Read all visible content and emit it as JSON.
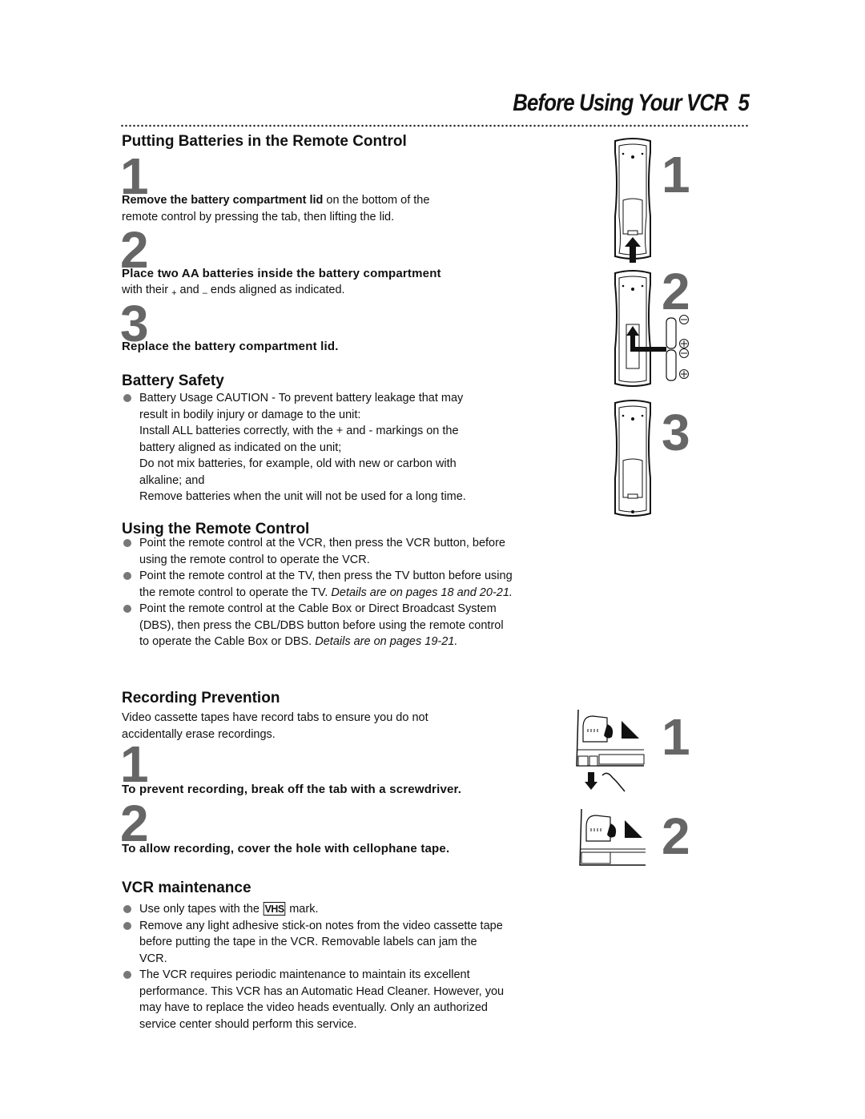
{
  "header": {
    "title": "Before Using Your VCR",
    "page_number": "5"
  },
  "batteries": {
    "heading": "Putting Batteries in the Remote Control",
    "steps": [
      {
        "number": "1",
        "bold": "Remove the battery compartment lid",
        "text": " on the bottom of the",
        "text2": "remote control by pressing the tab, then lifting the lid."
      },
      {
        "number": "2",
        "bold": "Place two AA batteries inside the battery compartment",
        "text_pre": "with their ",
        "plus": "+",
        "text_mid": " and ",
        "minus": "–",
        "text_post": " ends aligned as indicated."
      },
      {
        "number": "3",
        "bold": "Replace the battery compartment lid."
      }
    ]
  },
  "battery_safety": {
    "heading": "Battery Safety",
    "items": [
      {
        "lines": [
          "Battery Usage CAUTION - To prevent battery leakage that may",
          "result in bodily injury or damage to the unit:",
          "Install ALL batteries correctly, with the + and - markings on the",
          "battery aligned as indicated on the unit;",
          "Do not mix batteries, for example, old with new or carbon with",
          "alkaline; and",
          "Remove batteries when the unit will not be used for a long time."
        ]
      }
    ]
  },
  "using_remote": {
    "heading": "Using the Remote Control",
    "items": [
      {
        "text": "Point the remote control at the VCR, then press the VCR button, before using the remote control to operate the VCR.",
        "note": ""
      },
      {
        "text": "Point the remote control at the TV, then press the TV button before using the remote control to operate the TV. ",
        "note": "Details are on pages 18 and 20-21."
      },
      {
        "text": "Point the remote control at the Cable Box or Direct Broadcast System (DBS), then press the CBL/DBS button before using the remote control to operate the Cable Box or DBS. ",
        "note": "Details are on pages 19-21."
      }
    ]
  },
  "recording_prevention": {
    "heading": "Recording Prevention",
    "intro": "Video cassette tapes have record tabs to ensure you do not accidentally erase recordings.",
    "steps": [
      {
        "number": "1",
        "bold": "To prevent recording, break off the tab with a screwdriver."
      },
      {
        "number": "2",
        "bold": "To allow recording, cover the hole with cellophane tape."
      }
    ]
  },
  "vcr_maintenance": {
    "heading": "VCR maintenance",
    "item1_pre": "Use only tapes with the ",
    "vhs_mark": "VHS",
    "item1_post": " mark.",
    "items": [
      "Remove any light adhesive stick-on notes from the video cassette tape before putting the tape in the VCR. Removable labels can jam the VCR.",
      "The VCR requires periodic maintenance to maintain its excellent performance. This VCR has an Automatic Head Cleaner. However, you may have to replace the video heads eventually. Only an authorized service center should perform this service."
    ]
  },
  "illustrations": {
    "remote_steps": [
      "1",
      "2",
      "3"
    ],
    "battery_polarity": {
      "minus": "⊖",
      "plus": "⊕"
    },
    "cassette_steps": [
      "1",
      "2"
    ]
  }
}
